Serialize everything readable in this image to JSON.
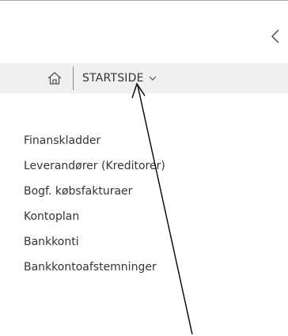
{
  "header": {
    "collapse_icon": "chevron-left-icon"
  },
  "nav": {
    "home_icon": "home-icon",
    "startside_label": "STARTSIDE",
    "startside_dropdown_icon": "chevron-down-icon"
  },
  "menu": {
    "items": [
      {
        "label": "Finanskladder"
      },
      {
        "label": "Leverandører (Kreditorer)"
      },
      {
        "label": "Bogf. købsfakturaer"
      },
      {
        "label": "Kontoplan"
      },
      {
        "label": "Bankkonti"
      },
      {
        "label": "Bankkontoafstemninger"
      }
    ]
  },
  "annotation": {
    "arrow_color": "#000000"
  }
}
